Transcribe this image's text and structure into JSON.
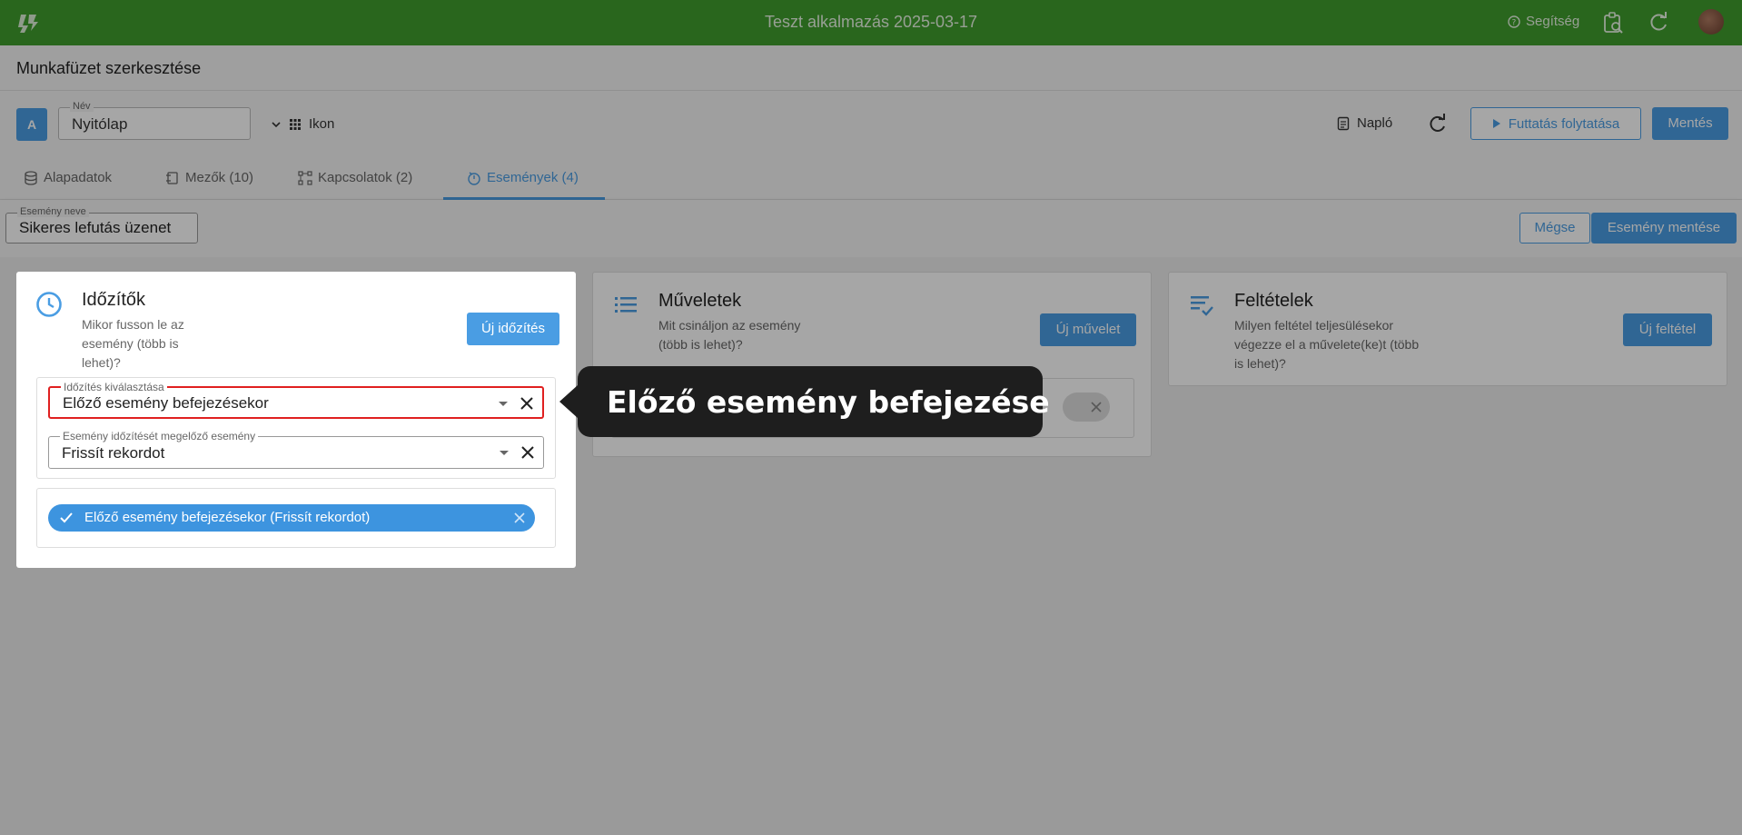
{
  "topbar": {
    "app_title": "Teszt alkalmazás 2025-03-17",
    "help_label": "Segítség",
    "bg_color": "#3f9d2d"
  },
  "page": {
    "title": "Munkafüzet szerkesztése"
  },
  "toolbar": {
    "avatar_letter": "A",
    "name_label": "Név",
    "name_value": "Nyitólap",
    "icon_label": "Ikon",
    "log_label": "Napló",
    "run_label": "Futtatás folytatása",
    "save_label": "Mentés"
  },
  "tabs": [
    {
      "label": "Alapadatok",
      "icon": "database-icon"
    },
    {
      "label": "Mezők (10)",
      "icon": "fields-icon"
    },
    {
      "label": "Kapcsolatok (2)",
      "icon": "relations-icon"
    },
    {
      "label": "Események (4)",
      "icon": "events-icon",
      "active": true
    }
  ],
  "event": {
    "name_label": "Esemény neve",
    "name_value": "Sikeres lefutás üzenet",
    "cancel_label": "Mégse",
    "save_label": "Esemény mentése"
  },
  "cards": {
    "timers": {
      "title": "Időzítők",
      "desc": "Mikor fusson le az esemény (több is lehet)?",
      "button": "Új időzítés",
      "select1": {
        "label": "Időzítés kiválasztása",
        "value": "Előző esemény befejezésekor"
      },
      "select2": {
        "label": "Esemény időzítését megelőző esemény",
        "value": "Frissít rekordot"
      },
      "chip": "Előző esemény befejezésekor (Frissít rekordot)"
    },
    "actions": {
      "title": "Műveletek",
      "desc": "Mit csináljon az esemény (több is lehet)?",
      "button": "Új művelet"
    },
    "conditions": {
      "title": "Feltételek",
      "desc": "Milyen feltétel teljesülésekor végezze el a művelete(ke)t (több is lehet)?",
      "button": "Új feltétel"
    }
  },
  "tooltip": {
    "text": "Előző esemény befejezése"
  },
  "colors": {
    "accent": "#4a9de3",
    "highlight_border": "#e02020",
    "tooltip_bg": "#1e1e1e"
  }
}
